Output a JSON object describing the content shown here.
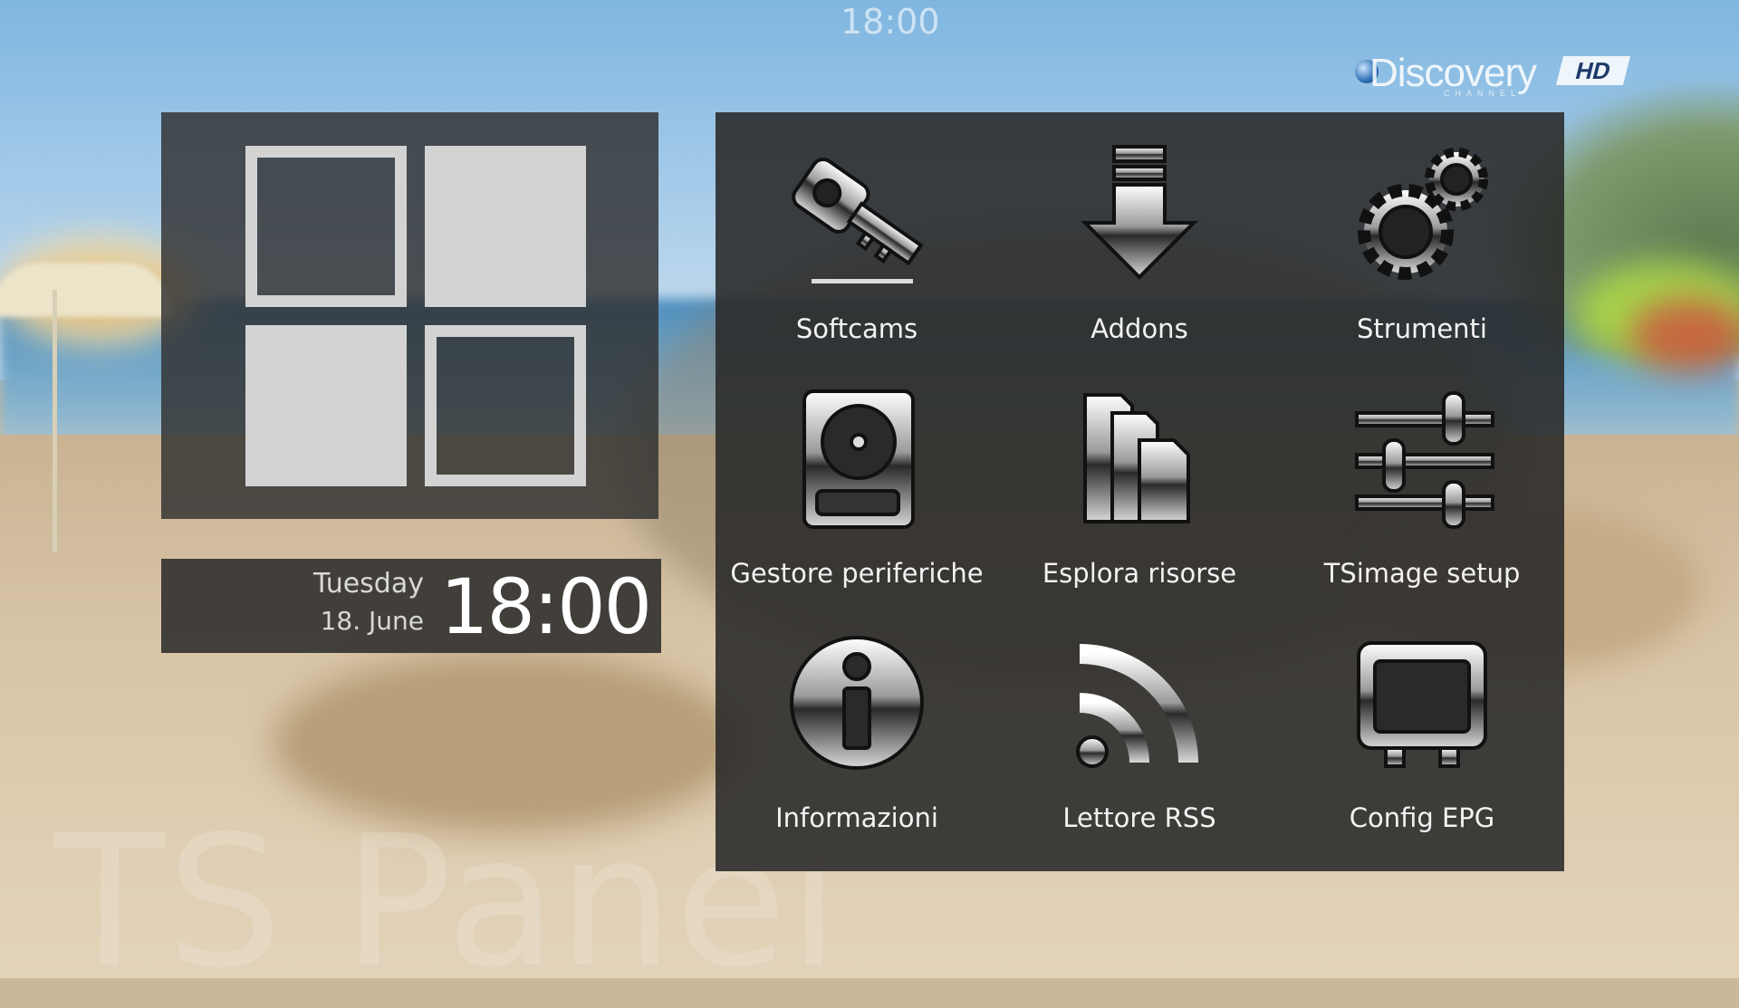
{
  "top_clock": "18:00",
  "channel_logo": {
    "name": "Discovery",
    "sub": "CHANNEL",
    "badge": "HD"
  },
  "watermark": "TS Panel",
  "clock": {
    "day": "Tuesday",
    "date": "18. June",
    "time": "18:00"
  },
  "menu": {
    "items": [
      {
        "label": "Softcams",
        "icon": "softcam-key-icon"
      },
      {
        "label": "Addons",
        "icon": "download-arrow-icon"
      },
      {
        "label": "Strumenti",
        "icon": "gears-icon"
      },
      {
        "label": "Gestore periferiche",
        "icon": "hard-drive-icon"
      },
      {
        "label": "Esplora risorse",
        "icon": "folders-icon"
      },
      {
        "label": "TSimage setup",
        "icon": "sliders-icon"
      },
      {
        "label": "Informazioni",
        "icon": "info-icon"
      },
      {
        "label": "Lettore RSS",
        "icon": "rss-icon"
      },
      {
        "label": "Config EPG",
        "icon": "tv-icon"
      }
    ]
  },
  "colors": {
    "panel": "#303030",
    "tile": "#d3d3d3",
    "text": "#f2f2f2"
  }
}
